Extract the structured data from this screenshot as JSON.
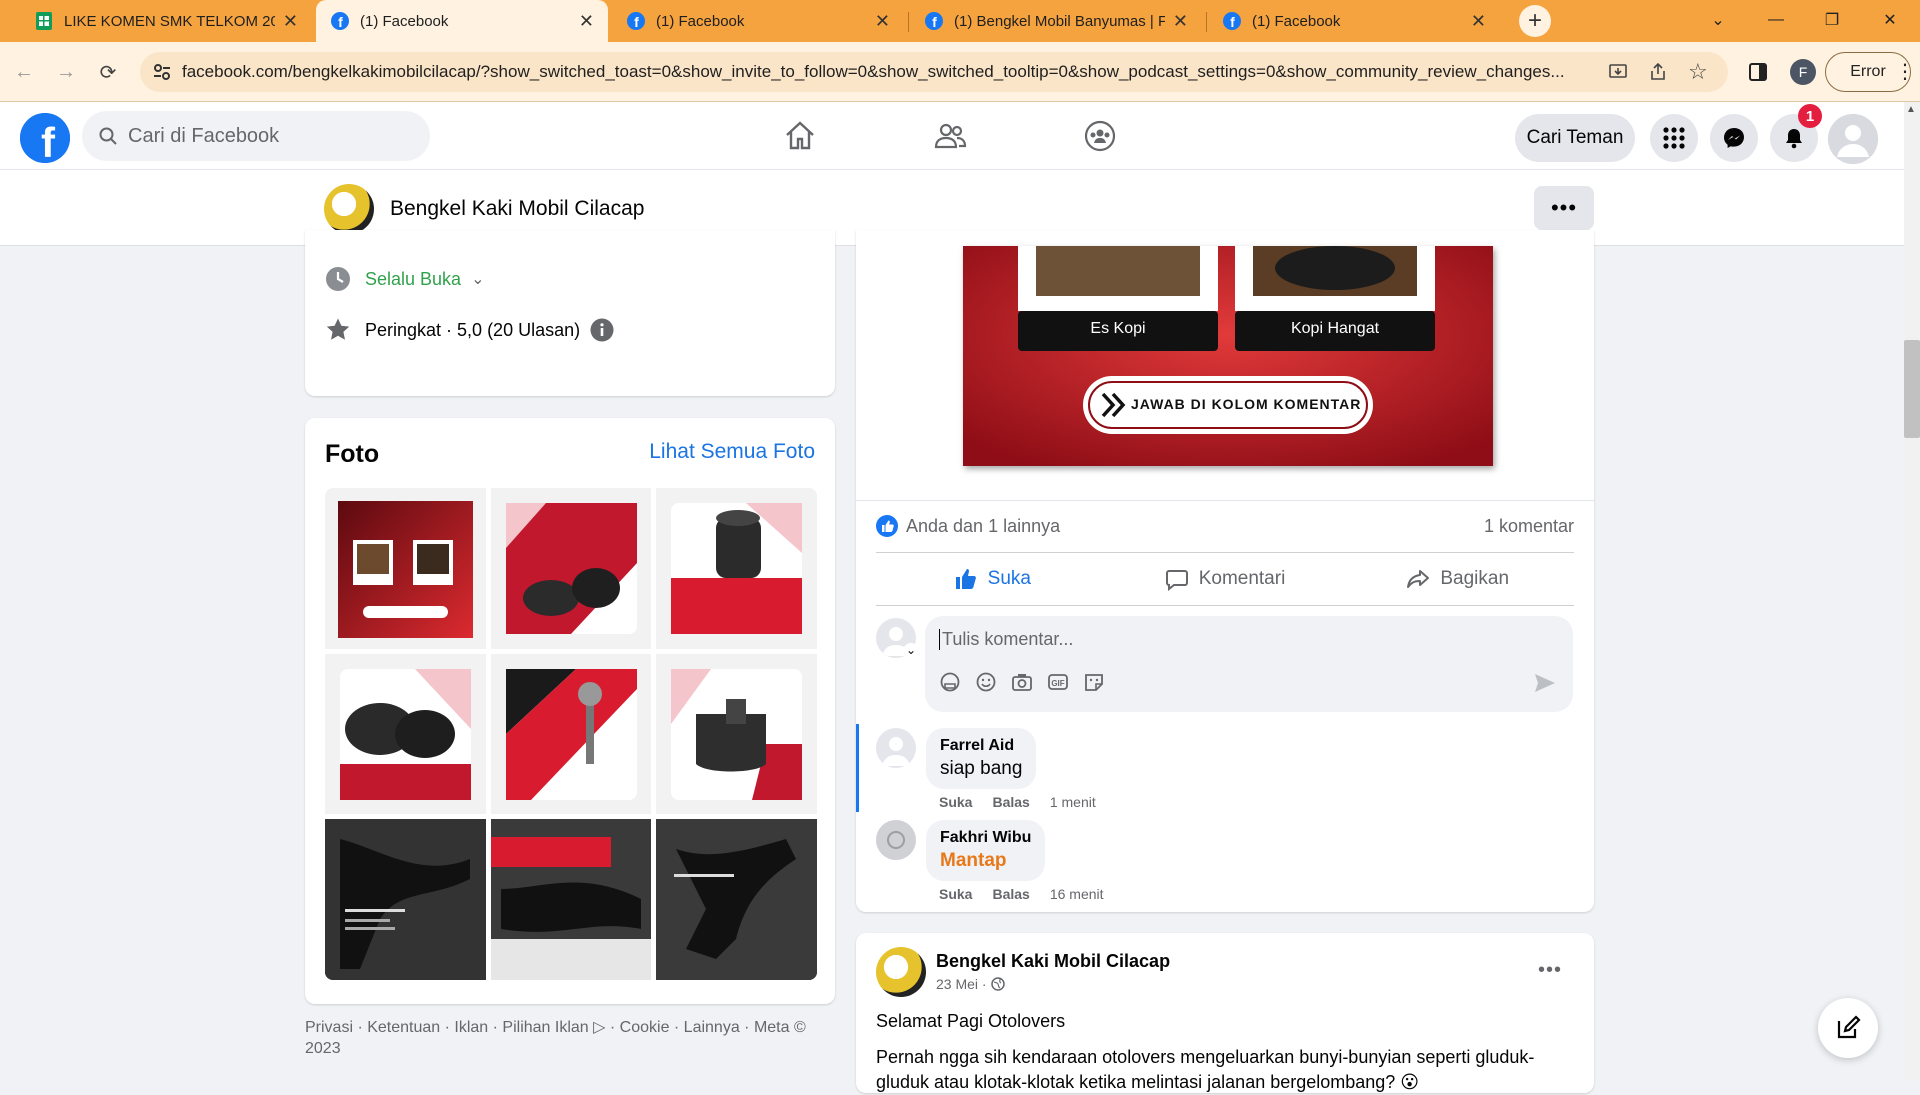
{
  "browser": {
    "tabs": [
      {
        "title": "LIKE KOMEN SMK TELKOM 2023",
        "icon": "sheets-icon",
        "active": false
      },
      {
        "title": "(1) Facebook",
        "icon": "facebook-icon",
        "active": true
      },
      {
        "title": "(1) Facebook",
        "icon": "facebook-icon",
        "active": false
      },
      {
        "title": "(1) Bengkel Mobil Banyumas | F",
        "icon": "facebook-icon",
        "active": false
      },
      {
        "title": "(1) Facebook",
        "icon": "facebook-icon",
        "active": false
      }
    ],
    "url": "facebook.com/bengkelkakimobilcilacap/?show_switched_toast=0&show_invite_to_follow=0&show_switched_tooltip=0&show_podcast_settings=0&show_community_review_changes...",
    "profile_letter": "F",
    "error_label": "Error",
    "colors": {
      "tabbar": "#f5a33f",
      "toolbar": "#fff2e0"
    }
  },
  "fb": {
    "search_placeholder": "Cari di Facebook",
    "find_friends": "Cari Teman",
    "notification_count": "1"
  },
  "page": {
    "name": "Bengkel Kaki Mobil Cilacap"
  },
  "about": {
    "open_status": "Selalu Buka",
    "rating": "Peringkat · 5,0 (20 Ulasan)"
  },
  "photos": {
    "title": "Foto",
    "see_all": "Lihat Semua Foto"
  },
  "footer": {
    "text": "Privasi · Ketentuan · Iklan · Pilihan Iklan ▷ · Cookie · Lainnya · Meta © 2023"
  },
  "post_image": {
    "left_caption": "Es Kopi",
    "right_caption": "Kopi Hangat",
    "cta": "JAWAB DI KOLOM KOMENTAR"
  },
  "post": {
    "reactions": "Anda dan 1 lainnya",
    "comment_count": "1 komentar",
    "like": "Suka",
    "comment": "Komentari",
    "share": "Bagikan",
    "comment_placeholder": "Tulis komentar..."
  },
  "comments": [
    {
      "name": "Farrel Aid",
      "text": "siap bang",
      "like": "Suka",
      "reply": "Balas",
      "time": "1 menit"
    },
    {
      "name": "Fakhri Wibu",
      "text": "Mantap",
      "like": "Suka",
      "reply": "Balas",
      "time": "16 menit"
    }
  ],
  "next_post": {
    "author": "Bengkel Kaki Mobil Cilacap",
    "date": "23 Mei ·",
    "greeting": "Selamat Pagi Otolovers",
    "body": "Pernah ngga sih kendaraan otolovers mengeluarkan bunyi-bunyian seperti gluduk-gluduk atau klotak-klotak ketika melintasi jalanan bergelombang? 😮"
  }
}
